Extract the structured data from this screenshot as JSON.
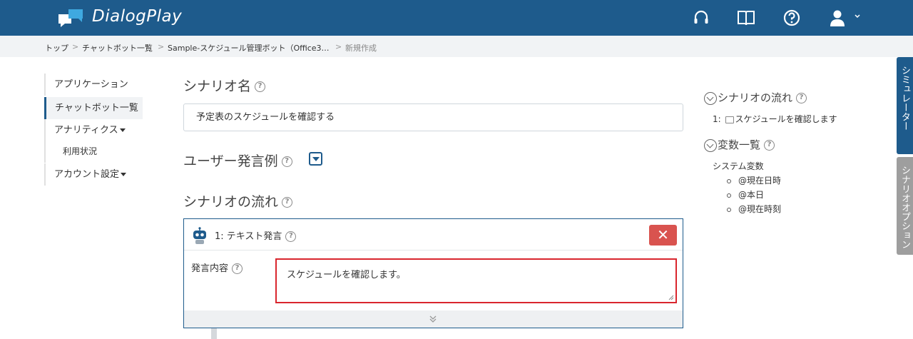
{
  "header": {
    "brand": "DialogPlay",
    "icons": [
      "headset-icon",
      "book-icon",
      "help-icon",
      "user-icon"
    ]
  },
  "breadcrumb": {
    "items": [
      "トップ",
      "チャットボット一覧",
      "Sample-スケジュール管理ボット（Office3…",
      "新規作成"
    ],
    "separator": ">"
  },
  "leftnav": {
    "items": [
      {
        "label": "アプリケーション"
      },
      {
        "label": "チャットボット一覧"
      },
      {
        "label": "アナリティクス"
      },
      {
        "label": "利用状況"
      },
      {
        "label": "アカウント設定"
      }
    ]
  },
  "main": {
    "scenario_name_title": "シナリオ名",
    "scenario_name_value": "予定表のスケジュールを確認する",
    "user_examples_title": "ユーザー発言例",
    "flow_title": "シナリオの流れ",
    "card": {
      "title": "1: テキスト発言",
      "close_label": "✕",
      "content_label": "発言内容",
      "content_value": "スケジュールを確認します。"
    },
    "help_mark": "?"
  },
  "right_panel": {
    "flow_title": "シナリオの流れ",
    "flow_item_prefix": "1:",
    "flow_item_text": "スケジュールを確認します",
    "vars_title": "変数一覧",
    "system_vars_label": "システム変数",
    "system_vars": [
      "@現在日時",
      "@本日",
      "@現在時刻"
    ]
  },
  "side_tabs": {
    "simulator": "シミュレーター",
    "options": "シナリオオプション"
  },
  "colors": {
    "brand": "#1e5b8c",
    "danger": "#d9534f",
    "highlight_border": "#d9262e"
  }
}
